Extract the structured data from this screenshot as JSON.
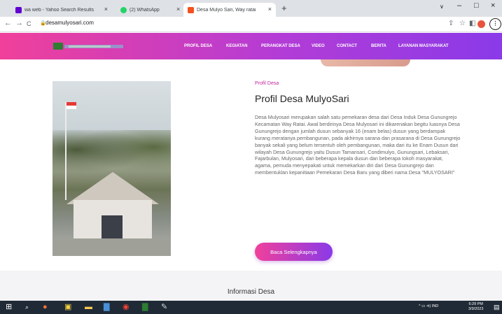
{
  "browser": {
    "tabs": [
      {
        "title": "wa web - Yahoo Search Results",
        "favicon_color": "#6001d2",
        "active": false
      },
      {
        "title": "(2) WhatsApp",
        "favicon_color": "#25d366",
        "active": false
      },
      {
        "title": "Desa Mulyo Sari, Way ratai",
        "favicon_color": "#f4511e",
        "active": true
      }
    ],
    "new_tab_glyph": "+",
    "close_glyph": "×",
    "window_controls": {
      "minimize": "–",
      "maximize": "□",
      "close": "×",
      "dropdown": "∨"
    },
    "nav": {
      "back": "←",
      "forward": "→",
      "reload": "C"
    },
    "url": "desamulyosari.com",
    "lock_glyph": "🔒",
    "toolbar_icons": {
      "share": "⇪",
      "star": "☆",
      "sidebar": "◧",
      "more": "⋮"
    }
  },
  "site": {
    "nav_items": [
      "PROFIL DESA",
      "KEGIATAN",
      "PERANGKAT DESA",
      "VIDEO",
      "CONTACT",
      "BERITA",
      "LAYANAN MASYARAKAT"
    ],
    "gradient": [
      "#f0409a",
      "#8a3ae8"
    ]
  },
  "profile": {
    "kicker": "Profil Desa",
    "title": "Profil Desa MulyoSari",
    "body": "Desa Mulyosari merupakan salah satu pemekaran desa dari Desa Induk Desa Gunungrejo Kecamatan Way Ratai. Awal berdirinya Desa Mulyosari ini dikarenakan begitu luasnya Desa Gunungrejo dengan jumlah dusun sebanyak 16 (enam belas) dusun yang berdampak kurang meratanya pembangunan, pada akhirnya sarana dan prasarana di Desa Gunungrejo banyak sekali yang belum tersentuh oleh pembangunan, maka dari itu ke Enam Dusun dari wilayah Desa Gunungrejo yaitu Dusun Tamansari, Condimulyo, Gunungsari, Lebaksari, Fajarbulan, Mulyosari, dari beberapa kepala dusun dan beberapa tokoh masyarakat, agama, pemuda menyepakati untuk memekarkan diri dari Desa Gunungrejo dan membentuklan kepanitiaan Pemekaran Desa Baru yang diberi nama Desa \"MULYOSARI\"",
    "cta": "Baca Selengkapnya"
  },
  "info": {
    "title": "Informasi Desa"
  },
  "taskbar": {
    "icons": [
      "windows-icon",
      "search-icon",
      "firefox-icon",
      "store-icon",
      "file-explorer-icon",
      "word-icon",
      "chrome-icon",
      "excel-icon",
      "paint-icon"
    ],
    "tray_text": "^  ▭  ⊲)  IND",
    "time": "6:29 PM",
    "date": "3/9/2023",
    "notification_glyph": "▤"
  }
}
